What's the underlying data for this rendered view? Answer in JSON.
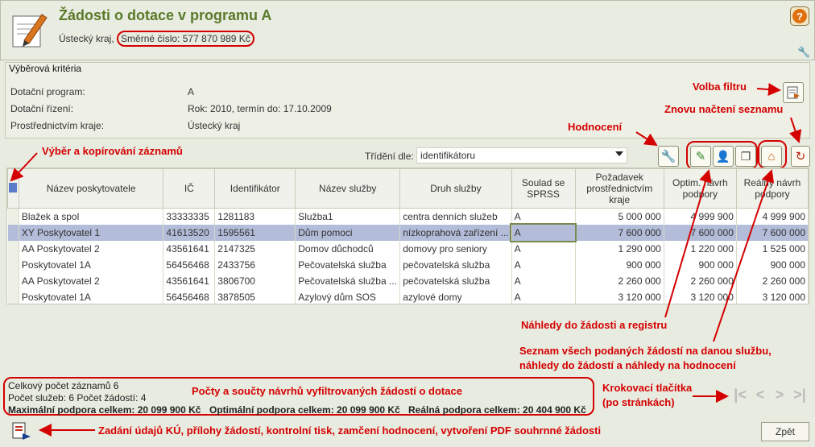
{
  "header": {
    "title": "Žádosti o dotace v programu A",
    "subtitle_region": "Ústecký kraj,",
    "subtitle_target": "Směrné číslo: 577 870 989 Kč"
  },
  "criteria": {
    "legend": "Výběrová kritéria",
    "rows": [
      {
        "label": "Dotační program:",
        "value": "A"
      },
      {
        "label": "Dotační řízení:",
        "value": "Rok: 2010, termín do: 17.10.2009"
      },
      {
        "label": "Prostřednictvím kraje:",
        "value": "Ústecký kraj"
      }
    ]
  },
  "sort": {
    "label": "Třídění dle:",
    "value": "identifikátoru"
  },
  "table": {
    "columns": [
      "Název poskytovatele",
      "IČ",
      "Identifikátor",
      "Název služby",
      "Druh služby",
      "Soulad se SPRSS",
      "Požadavek prostřednictvím kraje",
      "Optim. návrh podpory",
      "Reálný návrh podpory"
    ],
    "rows": [
      [
        "Blažek a spol",
        "33333335",
        "1281183",
        "Služba1",
        "centra denních služeb",
        "A",
        "5 000 000",
        "4 999 900",
        "4 999 900"
      ],
      [
        "XY Poskytovatel 1",
        "41613520",
        "1595561",
        "Dům pomoci",
        "nízkoprahová zařízení ...",
        "A",
        "7 600 000",
        "7 600 000",
        "7 600 000"
      ],
      [
        "AA Poskytovatel 2",
        "43561641",
        "2147325",
        "Domov důchodců",
        "domovy pro seniory",
        "A",
        "1 290 000",
        "1 220 000",
        "1 525 000"
      ],
      [
        "Poskytovatel 1A",
        "56456468",
        "2433756",
        "Pečovatelská služba",
        "pečovatelská služba",
        "A",
        "900 000",
        "900 000",
        "900 000"
      ],
      [
        "AA Poskytovatel 2",
        "43561641",
        "3806700",
        "Pečovatelská služba ...",
        "pečovatelská služba",
        "A",
        "2 260 000",
        "2 260 000",
        "2 260 000"
      ],
      [
        "Poskytovatel 1A",
        "56456468",
        "3878505",
        "Azylový dům SOS",
        "azylové domy",
        "A",
        "3 120 000",
        "3 120 000",
        "3 120 000"
      ]
    ]
  },
  "summary": {
    "line1": "Celkový počet záznamů 6",
    "line2": "Počet služeb: 6 Počet žádostí: 4",
    "max": "Maximální podpora celkem: 20 099 900 Kč",
    "opt": "Optimální podpora celkem: 20 099 900 Kč",
    "real": "Reálná podpora celkem: 20 404 900 Kč"
  },
  "annotations": {
    "filter": "Volba filtru",
    "reload": "Znovu načtení seznamu",
    "rating": "Hodnocení",
    "select_copy": "Výběr a kopírování záznamů",
    "previews": "Náhledy do žádosti a registru",
    "list_all_1": "Seznam všech podaných žádostí na danou službu,",
    "list_all_2": "náhledy do žádostí a náhledy na hodnocení",
    "paging_1": "Krokovací tlačítka",
    "paging_2": "(po stránkách)",
    "counts": "Počty a součty návrhů vyfiltrovaných žádostí o dotace",
    "bottom": "Zadání údajů KÚ, přílohy žádostí, kontrolní tisk, zamčení hodnocení, vytvoření PDF souhrnné žádosti"
  },
  "buttons": {
    "back": "Zpět"
  },
  "colors": {
    "accent_green": "#5a7a2a",
    "annotation_red": "#d40000",
    "selected_row": "#b3bcd8"
  }
}
